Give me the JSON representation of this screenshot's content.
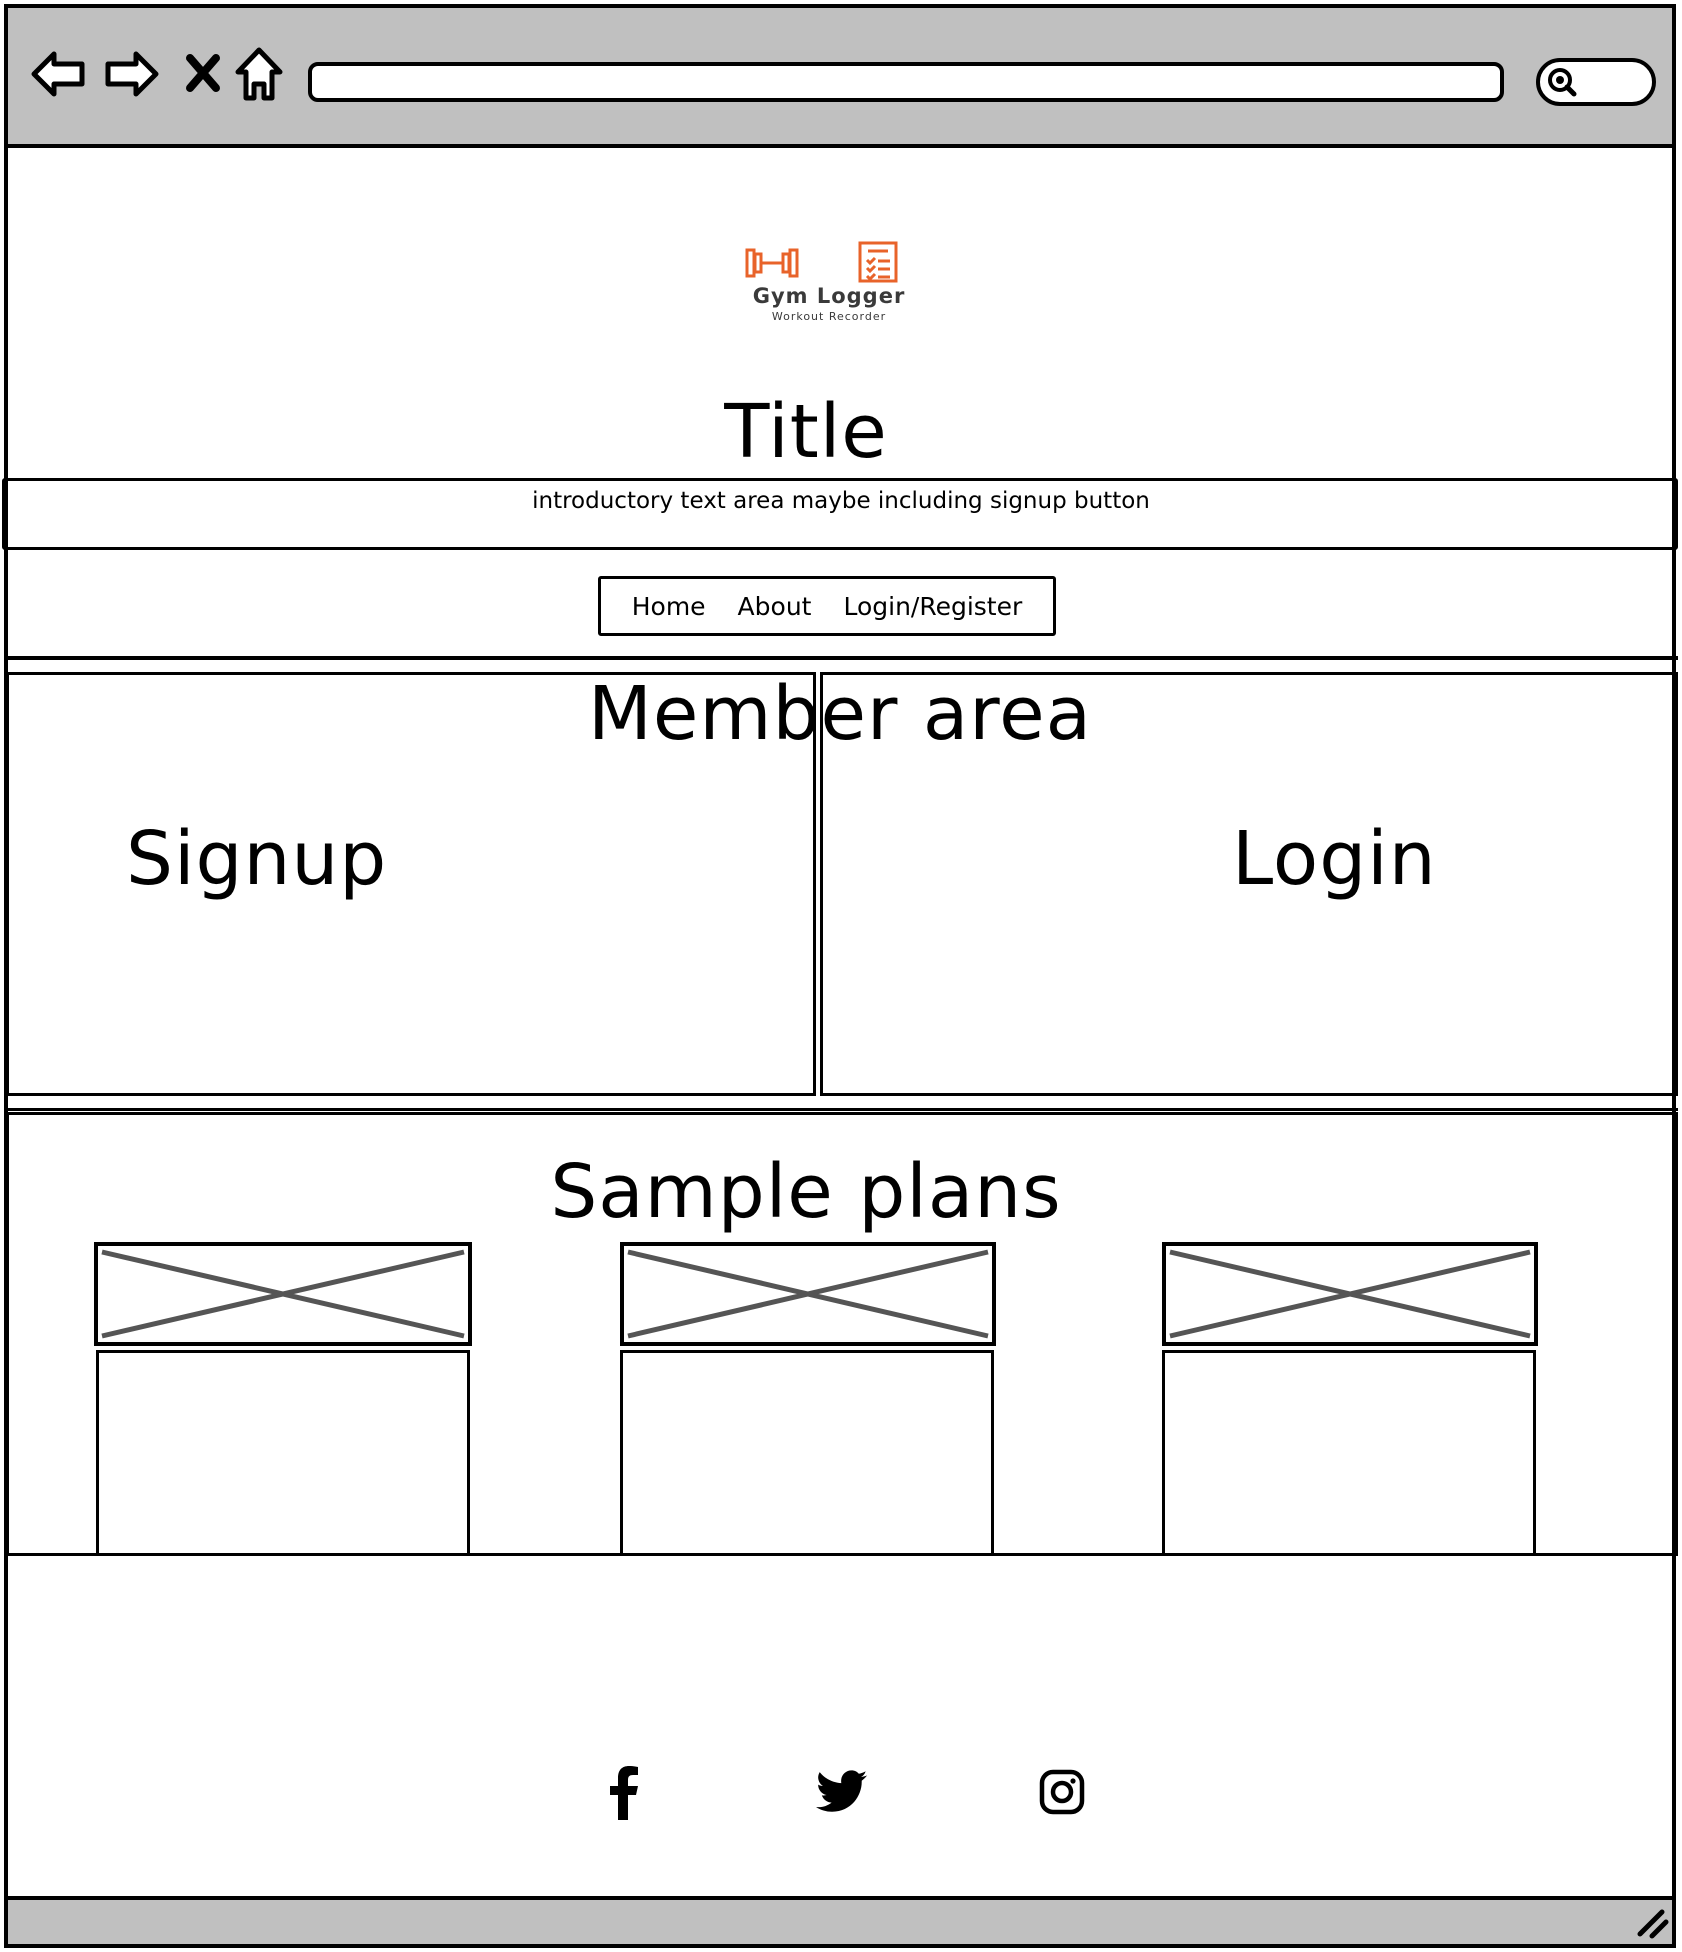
{
  "brand": {
    "name": "Gym Logger",
    "tagline": "Workout Recorder",
    "accent_color": "#e8632a"
  },
  "browser": {
    "icons": [
      "back-arrow-icon",
      "forward-arrow-icon",
      "close-icon",
      "home-icon",
      "search-icon"
    ]
  },
  "page": {
    "title": "Title",
    "intro": "introductory text area maybe including signup button"
  },
  "nav": {
    "items": [
      {
        "label": "Home"
      },
      {
        "label": "About"
      },
      {
        "label": "Login/Register"
      }
    ]
  },
  "members": {
    "heading": "Member area",
    "signup": "Signup",
    "login": "Login"
  },
  "plans": {
    "heading": "Sample plans",
    "cards": 3
  },
  "footer": {
    "social": [
      "facebook-icon",
      "twitter-icon",
      "instagram-icon"
    ]
  }
}
